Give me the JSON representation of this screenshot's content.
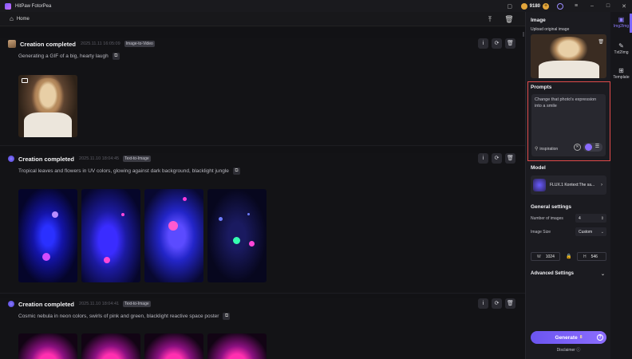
{
  "app": {
    "title": "HitPaw FotorPea",
    "credits": "9180"
  },
  "homebar": {
    "home_label": "Home"
  },
  "feed": {
    "cards": [
      {
        "title": "Creation completed",
        "time": "2025.11.11  16:05:09",
        "tag": "Image-to-Video",
        "prompt": "Generating a GIF of a big, hearty laugh"
      },
      {
        "title": "Creation completed",
        "time": "2025.11.10  18:04:45",
        "tag": "Text-to-Image",
        "prompt": "Tropical leaves and flowers in UV colors, glowing against dark background, blacklight jungle"
      },
      {
        "title": "Creation completed",
        "time": "2025.11.10  18:04:41",
        "tag": "Text-to-Image",
        "prompt": "Cosmic nebula in neon colors, swirls of pink and green, blacklight reactive space poster"
      }
    ]
  },
  "panel": {
    "image_label": "Image",
    "upload_label": "Upload original image",
    "prompts_label": "Prompts",
    "prompt_value": "Change that photo's expression into a smile",
    "inspiration_label": "inspiration",
    "model_label": "Model",
    "model_name": "FLUX.1 Kontext:The sa...",
    "general_label": "General settings",
    "num_images_label": "Number of images",
    "num_images_value": "4",
    "image_size_label": "Image Size",
    "image_size_value": "Custom",
    "w_label": "W",
    "w_value": "1024",
    "h_label": "H",
    "h_value": "546",
    "advanced_label": "Advanced Settings",
    "generate_label": "Generate",
    "generate_cost": "8",
    "disclaimer": "Disclaimer"
  },
  "rail": [
    {
      "label": "Img2Img",
      "icon": "image-icon"
    },
    {
      "label": "Txt2Img",
      "icon": "edit-icon"
    },
    {
      "label": "Template",
      "icon": "grid-icon"
    }
  ],
  "colors": {
    "accent": "#7a66ff",
    "highlight_border": "#e04a4a",
    "coin": "#e2a53b"
  }
}
